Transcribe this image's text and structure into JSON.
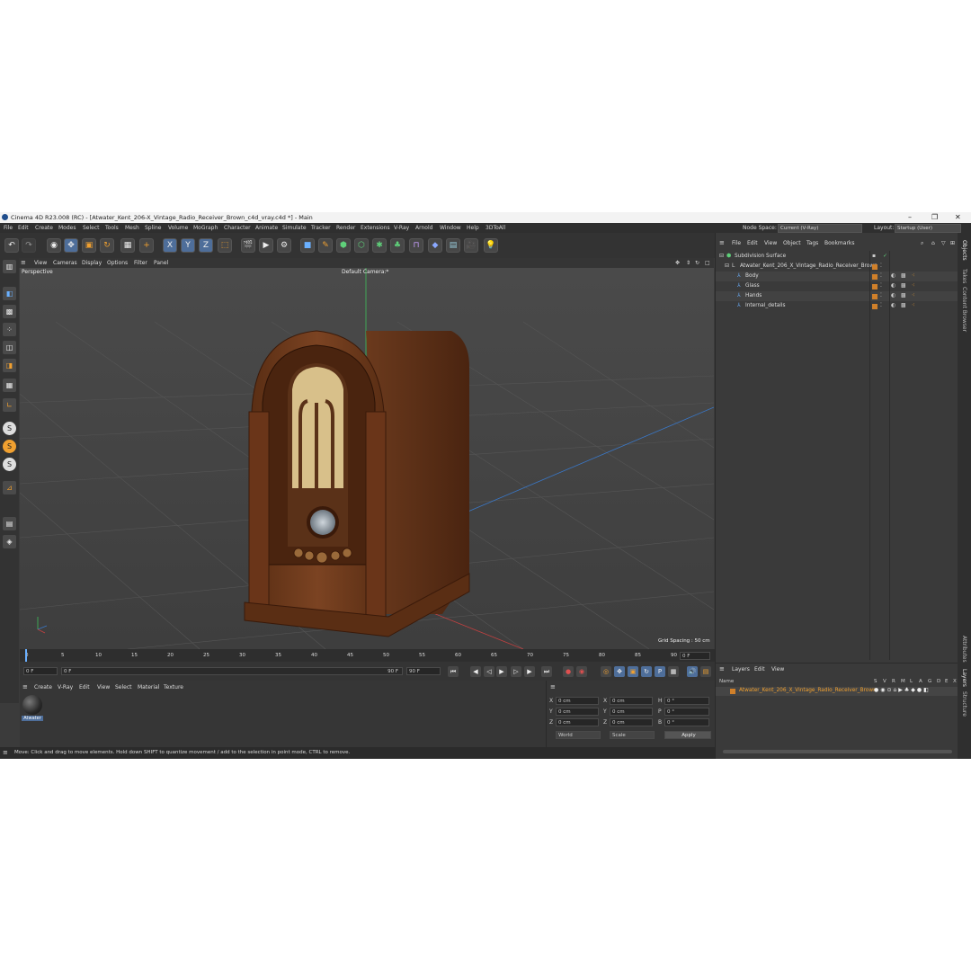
{
  "window": {
    "title": "Cinema 4D R23.008 (RC) - [Atwater_Kent_206-X_Vintage_Radio_Receiver_Brown_c4d_vray.c4d *] - Main",
    "controls": [
      "–",
      "❐",
      "✕"
    ]
  },
  "menu": [
    "File",
    "Edit",
    "Create",
    "Modes",
    "Select",
    "Tools",
    "Mesh",
    "Spline",
    "Volume",
    "MoGraph",
    "Character",
    "Animate",
    "Simulate",
    "Tracker",
    "Render",
    "Extensions",
    "V-Ray",
    "Arnold",
    "Window",
    "Help",
    "3DToAll"
  ],
  "node_space": {
    "label": "Node Space:",
    "value": "Current (V-Ray)"
  },
  "layout": {
    "label": "Layout:",
    "value": "Startup (User)"
  },
  "toolbar": {
    "axis_x": "X",
    "axis_y": "Y",
    "axis_z": "Z"
  },
  "viewport": {
    "menu": [
      "View",
      "Cameras",
      "Display",
      "Options",
      "Filter",
      "Panel"
    ],
    "label": "Perspective",
    "camera": "Default Camera",
    "camera_mark": ":*",
    "grid_spacing": "Grid Spacing : 50 cm"
  },
  "timeline": {
    "ticks": [
      "0",
      "5",
      "10",
      "15",
      "20",
      "25",
      "30",
      "35",
      "40",
      "45",
      "50",
      "55",
      "60",
      "65",
      "70",
      "75",
      "80",
      "85",
      "90"
    ],
    "end_frame": "0 F"
  },
  "transport": {
    "current": "0 F",
    "start": "0 F",
    "end": "90 F",
    "end2": "90 F"
  },
  "materials": {
    "menu": [
      "Create",
      "V-Ray",
      "Edit",
      "View",
      "Select",
      "Material",
      "Texture"
    ],
    "items": [
      {
        "name": "Atwater"
      }
    ]
  },
  "coords": {
    "rows": [
      {
        "a": "X",
        "av": "0 cm",
        "b": "X",
        "bv": "0 cm",
        "c": "H",
        "cv": "0 °"
      },
      {
        "a": "Y",
        "av": "0 cm",
        "b": "Y",
        "bv": "0 cm",
        "c": "P",
        "cv": "0 °"
      },
      {
        "a": "Z",
        "av": "0 cm",
        "b": "Z",
        "bv": "0 cm",
        "c": "B",
        "cv": "0 °"
      }
    ],
    "mode1": "World",
    "mode2": "Scale",
    "apply": "Apply"
  },
  "status": "Move: Click and drag to move elements. Hold down SHIFT to quantize movement / add to the selection in point mode, CTRL to remove.",
  "objects": {
    "menu": [
      "File",
      "Edit",
      "View",
      "Object",
      "Tags",
      "Bookmarks"
    ],
    "items": [
      {
        "name": "Subdivision Surface",
        "indent": 0
      },
      {
        "name": "Atwater_Kent_206_X_Vintage_Radio_Receiver_Brown",
        "indent": 1
      },
      {
        "name": "Body",
        "indent": 2
      },
      {
        "name": "Glass",
        "indent": 2
      },
      {
        "name": "Hands",
        "indent": 2
      },
      {
        "name": "Internal_details",
        "indent": 2
      }
    ]
  },
  "layers": {
    "menu": [
      "Layers",
      "Edit",
      "View"
    ],
    "name_header": "Name",
    "columns": [
      "S",
      "V",
      "R",
      "M",
      "L",
      "A",
      "G",
      "D",
      "E",
      "X"
    ],
    "row": "Atwater_Kent_206_X_Vintage_Radio_Receiver_Brown"
  },
  "sidetabs": [
    "Objects",
    "Takes",
    "Content Browser",
    "Attributes",
    "Layers",
    "Structure"
  ],
  "colors": {
    "accent": "#4e6e9a",
    "orange": "#d0802a",
    "wood": "#6b3a1d"
  }
}
